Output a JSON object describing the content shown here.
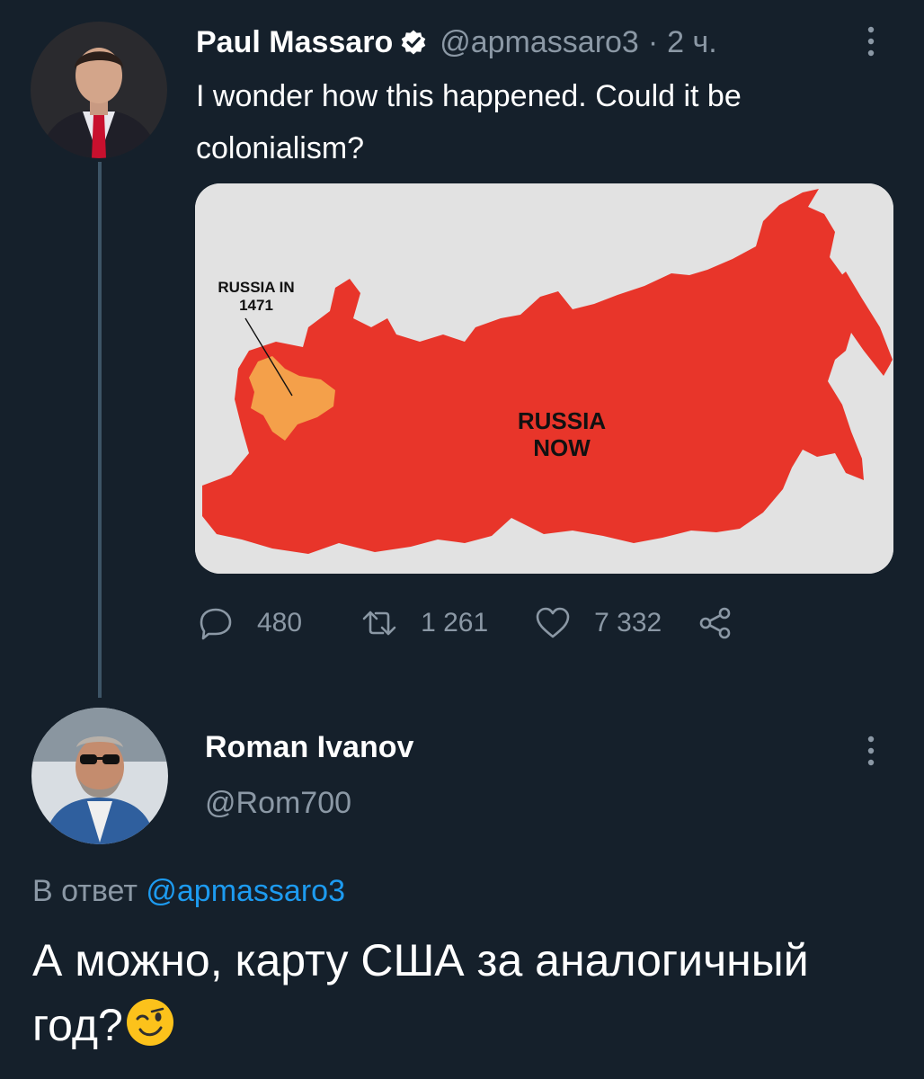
{
  "tweet": {
    "author_name": "Paul Massaro",
    "handle": "@apmassaro3",
    "separator": "·",
    "time": "2 ч.",
    "text": "I wonder how this happened. Could it be colonialism?",
    "media": {
      "label_old": "RUSSIA IN 1471",
      "label_now": "RUSSIA NOW",
      "fill_now": "#e8352a",
      "fill_old": "#f4a04a"
    },
    "actions": {
      "replies": "480",
      "retweets": "1 261",
      "likes": "7 332"
    }
  },
  "reply": {
    "author_name": "Roman Ivanov",
    "handle": "@Rom700",
    "reply_to_label": "В ответ",
    "reply_to_handle": "@apmassaro3",
    "text": "А можно, карту США за аналогичный год?"
  },
  "colors": {
    "background": "#15202b",
    "secondary_text": "#8b98a5",
    "link": "#1d9bf0"
  }
}
